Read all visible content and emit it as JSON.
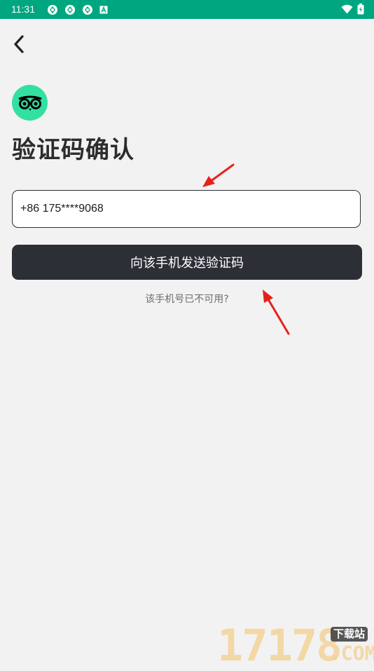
{
  "status_bar": {
    "time": "11:31",
    "background_color": "#00a680",
    "left_icons": [
      "sync-icon",
      "sync-icon",
      "sync-icon",
      "a-badge-icon"
    ],
    "right_icons": [
      "wifi-icon",
      "battery-icon"
    ]
  },
  "header": {
    "back_icon": "chevron-left-icon"
  },
  "logo": {
    "icon": "owl-eyes-icon",
    "color": "#34e0a1"
  },
  "page": {
    "title": "验证码确认"
  },
  "phone_field": {
    "value": "+86 175****9068"
  },
  "send_button": {
    "label": "向该手机发送验证码",
    "color": "#2d2f36"
  },
  "unavailable_link": {
    "label": "该手机号已不可用?"
  },
  "annotations": {
    "arrow_color": "#e8201b"
  },
  "watermark": {
    "number": "17178",
    "tag": "下载站",
    "suffix": ".COM"
  }
}
